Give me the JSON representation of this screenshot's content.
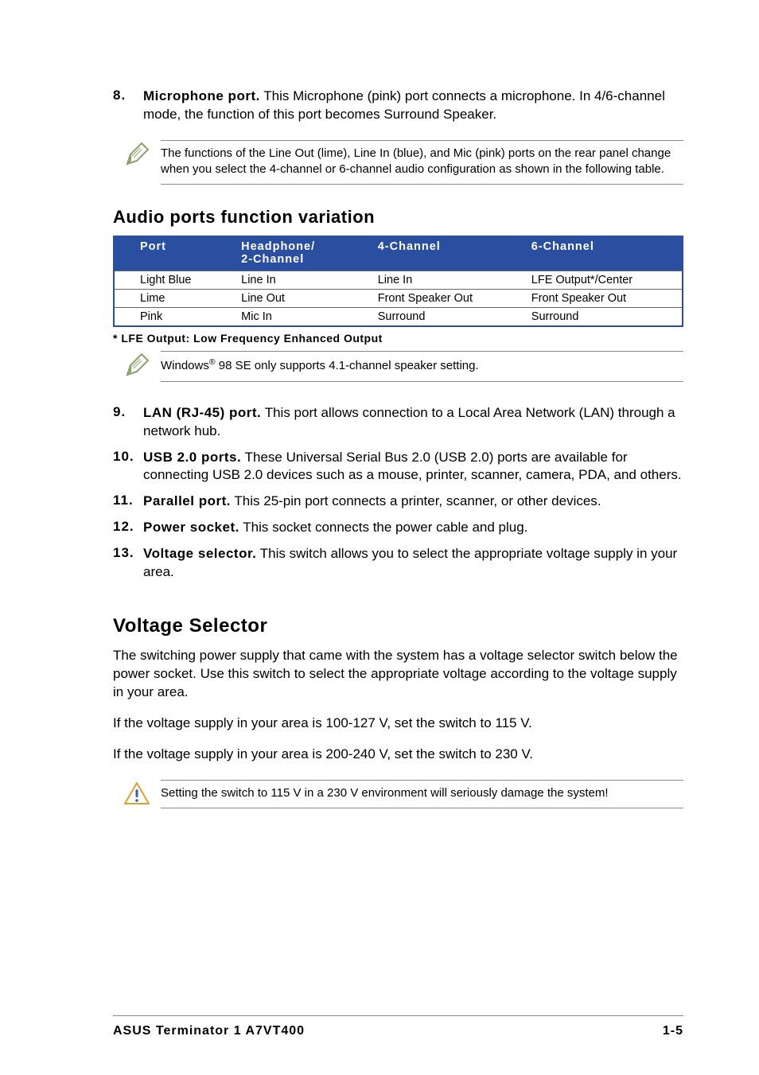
{
  "items": {
    "i8": {
      "num": "8.",
      "title": "Microphone port.",
      "text": " This Microphone (pink) port connects a microphone. In 4/6-channel mode, the function of this port becomes Surround Speaker."
    },
    "i9": {
      "num": "9.",
      "title": "LAN (RJ-45) port.",
      "text": " This port allows connection to a Local Area Network (LAN) through a network hub."
    },
    "i10": {
      "num": "10.",
      "title": "USB 2.0 ports.",
      "text": " These Universal Serial Bus 2.0 (USB 2.0) ports are available for connecting USB 2.0 devices such as a mouse, printer, scanner, camera, PDA, and others."
    },
    "i11": {
      "num": "11.",
      "title": "Parallel port.",
      "text": " This 25-pin port connects a printer, scanner, or other devices."
    },
    "i12": {
      "num": "12.",
      "title": "Power socket.",
      "text": " This socket connects the power cable and plug."
    },
    "i13": {
      "num": "13.",
      "title": "Voltage selector.",
      "text": " This switch allows you to select the appropriate voltage supply in your area."
    }
  },
  "notes": {
    "n1": "The functions of the Line Out (lime), Line In (blue), and Mic (pink) ports on the rear panel change when you select the 4-channel or 6-channel audio configuration as shown in the following table.",
    "n2_pre": "Windows",
    "n2_sup": "®",
    "n2_post": " 98 SE only supports 4.1-channel speaker setting.",
    "n3": "Setting the switch to 115 V in a 230 V environment will seriously damage the system!"
  },
  "audio_heading": "Audio ports function variation",
  "audio_table": {
    "head": {
      "c1": "Port",
      "c2a": "Headphone/",
      "c2b": "2-Channel",
      "c3": "4-Channel",
      "c4": "6-Channel"
    },
    "rows": [
      {
        "c1": "Light Blue",
        "c2": "Line In",
        "c3": "Line In",
        "c4": "LFE Output*/Center"
      },
      {
        "c1": "Lime",
        "c2": "Line Out",
        "c3": "Front Speaker Out",
        "c4": "Front Speaker Out"
      },
      {
        "c1": "Pink",
        "c2": "Mic In",
        "c3": "Surround",
        "c4": "Surround"
      }
    ],
    "footnote": "* LFE Output: Low Frequency Enhanced Output"
  },
  "voltage": {
    "heading": "Voltage Selector",
    "p1": "The switching power supply that came with the system has a voltage selector switch below the power socket. Use this switch to select the appropriate voltage according to the voltage supply in your area.",
    "p2": "If the voltage supply in your area is 100-127 V, set the switch to 115 V.",
    "p3": "If the voltage supply in your area is 200-240 V, set the switch to 230 V."
  },
  "footer": {
    "left": "ASUS Terminator 1 A7VT400",
    "right": "1-5"
  }
}
